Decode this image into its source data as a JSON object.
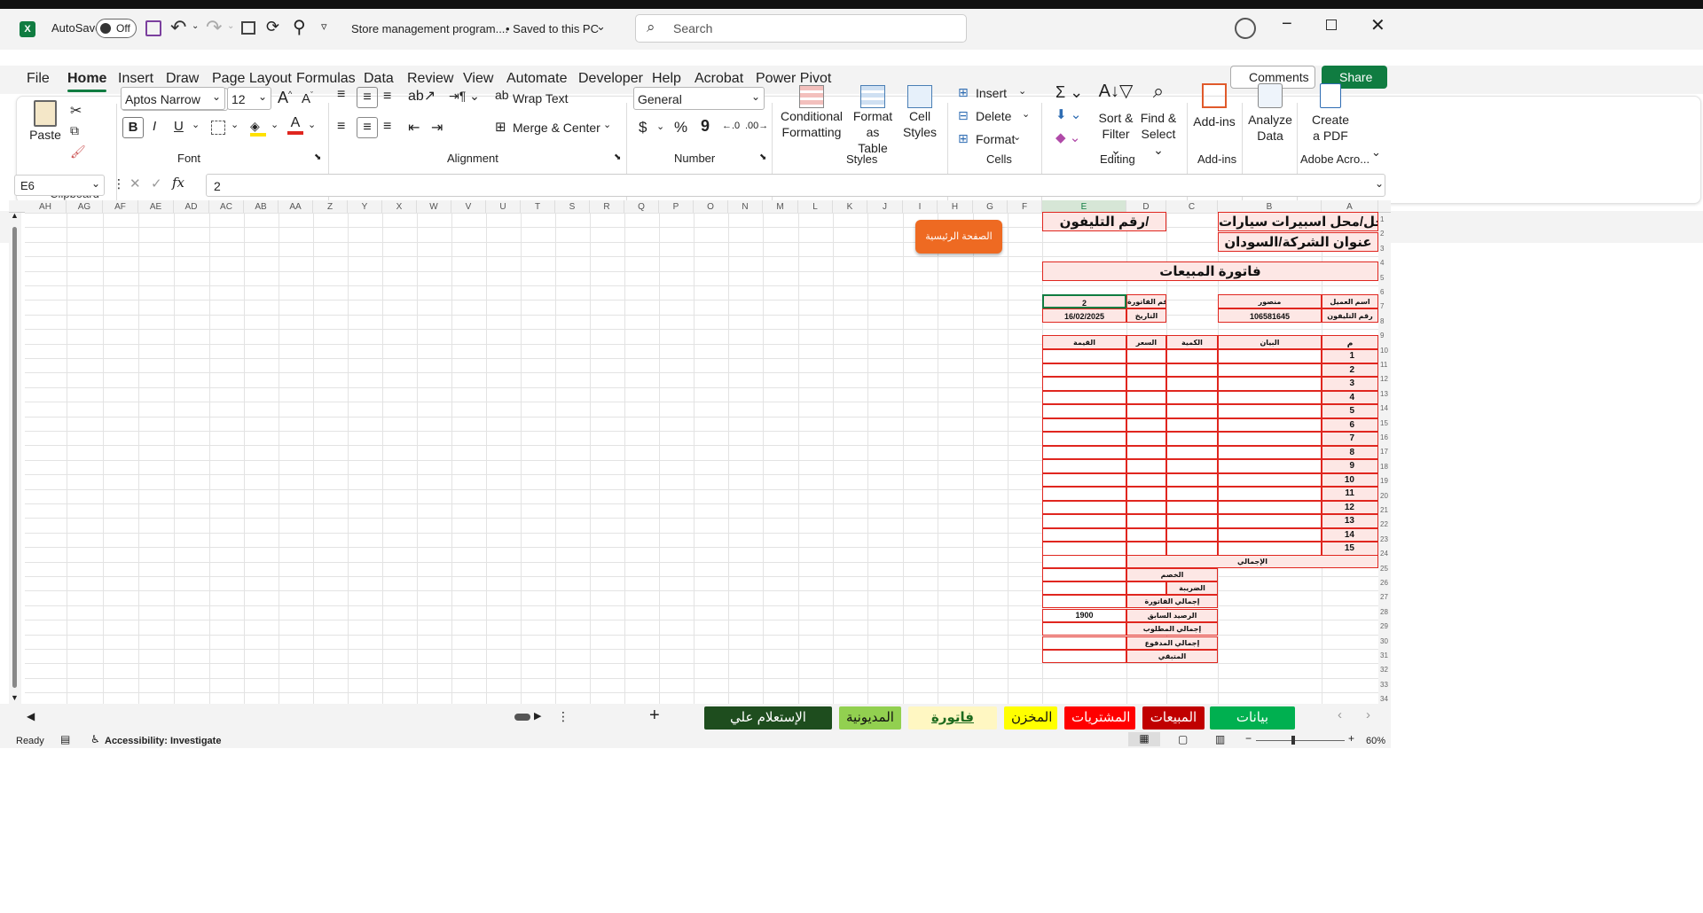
{
  "titlebar": {
    "autosave": "AutoSave",
    "toggle": "Off",
    "doc_title": "Store management program....",
    "save_state": "• Saved to this PC",
    "search_placeholder": "Search"
  },
  "tabs": [
    "File",
    "Home",
    "Insert",
    "Draw",
    "Page Layout",
    "Formulas",
    "Data",
    "Review",
    "View",
    "Automate",
    "Developer",
    "Help",
    "Acrobat",
    "Power Pivot"
  ],
  "right_buttons": {
    "comments": "Comments",
    "share": "Share"
  },
  "ribbon": {
    "clipboard": {
      "paste": "Paste",
      "label": "Clipboard"
    },
    "font": {
      "name": "Aptos Narrow",
      "size": "12",
      "label": "Font",
      "bold": "B",
      "italic": "I",
      "underline": "U"
    },
    "alignment": {
      "wrap": "Wrap Text",
      "merge": "Merge & Center",
      "label": "Alignment"
    },
    "number": {
      "format": "General",
      "currency": "$",
      "percent": "%",
      "comma": "9",
      "label": "Number"
    },
    "styles": {
      "cond1": "Conditional",
      "cond2": "Formatting",
      "fmt1": "Format as",
      "fmt2": "Table",
      "cell1": "Cell",
      "cell2": "Styles",
      "label": "Styles"
    },
    "cells": {
      "insert": "Insert",
      "delete": "Delete",
      "format": "Format",
      "label": "Cells"
    },
    "editing": {
      "sort1": "Sort &",
      "sort2": "Filter",
      "find1": "Find &",
      "find2": "Select",
      "label": "Editing"
    },
    "addins": {
      "addins": "Add-ins",
      "label": "Add-ins"
    },
    "analyze": {
      "l1": "Analyze",
      "l2": "Data"
    },
    "acrobat": {
      "l1": "Create",
      "l2": "a PDF",
      "label": "Adobe Acro..."
    }
  },
  "formula_bar": {
    "name_box": "E6",
    "fx": "fx",
    "value": "2"
  },
  "columns": [
    "AH",
    "AG",
    "AF",
    "AE",
    "AD",
    "AC",
    "AB",
    "AA",
    "Z",
    "Y",
    "X",
    "W",
    "V",
    "U",
    "T",
    "S",
    "R",
    "Q",
    "P",
    "O",
    "N",
    "M",
    "L",
    "K",
    "J",
    "I",
    "H",
    "G",
    "F",
    "E",
    "D",
    "C",
    "B",
    "A"
  ],
  "home_button": "الصفحة الرئيسية",
  "invoice": {
    "shop_name": "اسم المحل/محل اسبيرات سيارات",
    "phone_hdr": "رقم التليفون/",
    "address": "عنوان الشركة/السودان",
    "title": "فاتورة المبيعات",
    "customer_label": "اسم العميل",
    "customer_value": "منصور",
    "invoice_no_label": "رقم الفاتورة",
    "invoice_no_value": "2",
    "phone_label": "رقم التليفون",
    "phone_value": "106581645",
    "date_label": "التاريخ",
    "date_value": "16/02/2025",
    "col_no": "م",
    "col_desc": "البيان",
    "col_qty": "الكمية",
    "col_price": "السعر",
    "col_value": "القيمة",
    "rows": [
      "1",
      "2",
      "3",
      "4",
      "5",
      "6",
      "7",
      "8",
      "9",
      "10",
      "11",
      "12",
      "13",
      "14",
      "15"
    ],
    "total": "الإجمالي",
    "discount": "الخصم",
    "tax": "الضريبة",
    "invoice_total": "إجمالي الفاتورة",
    "prev_balance": "الرصيد السابق",
    "prev_balance_value": "1900",
    "total_due": "إجمالي المطلوب",
    "total_paid": "إجمالي المدفوع",
    "remaining": "المتبقي"
  },
  "sheets": [
    {
      "name": "الإستعلام علي الفواتير",
      "bg": "#1e4d1e",
      "fg": "#ffffff"
    },
    {
      "name": "المديونية",
      "bg": "#92d050",
      "fg": "#111111"
    },
    {
      "name": "فاتورة المبيعات",
      "bg": "#fff7c2",
      "fg": "#1e6b1e"
    },
    {
      "name": "المخزن",
      "bg": "#ffff00",
      "fg": "#111111"
    },
    {
      "name": "المشتريات",
      "bg": "#ff0000",
      "fg": "#ffffff"
    },
    {
      "name": "المبيعات",
      "bg": "#c00000",
      "fg": "#ffffff"
    },
    {
      "name": "بيانات العملاء",
      "bg": "#00b050",
      "fg": "#ffffff"
    }
  ],
  "status": {
    "ready": "Ready",
    "accessibility": "Accessibility: Investigate",
    "zoom": "60%"
  },
  "row_numbers": [
    "1",
    "2",
    "3",
    "4",
    "5",
    "6",
    "7",
    "8",
    "9",
    "10",
    "11",
    "12",
    "13",
    "14",
    "15",
    "16",
    "17",
    "18",
    "19",
    "20",
    "21",
    "22",
    "23",
    "24",
    "25",
    "26",
    "27",
    "28",
    "29",
    "30",
    "31",
    "32",
    "33",
    "34"
  ],
  "colors": {
    "accent": "#107c41",
    "cell_border": "#e0261f",
    "cell_fill": "#fde7e5",
    "home_btn": "#ee6a22"
  }
}
